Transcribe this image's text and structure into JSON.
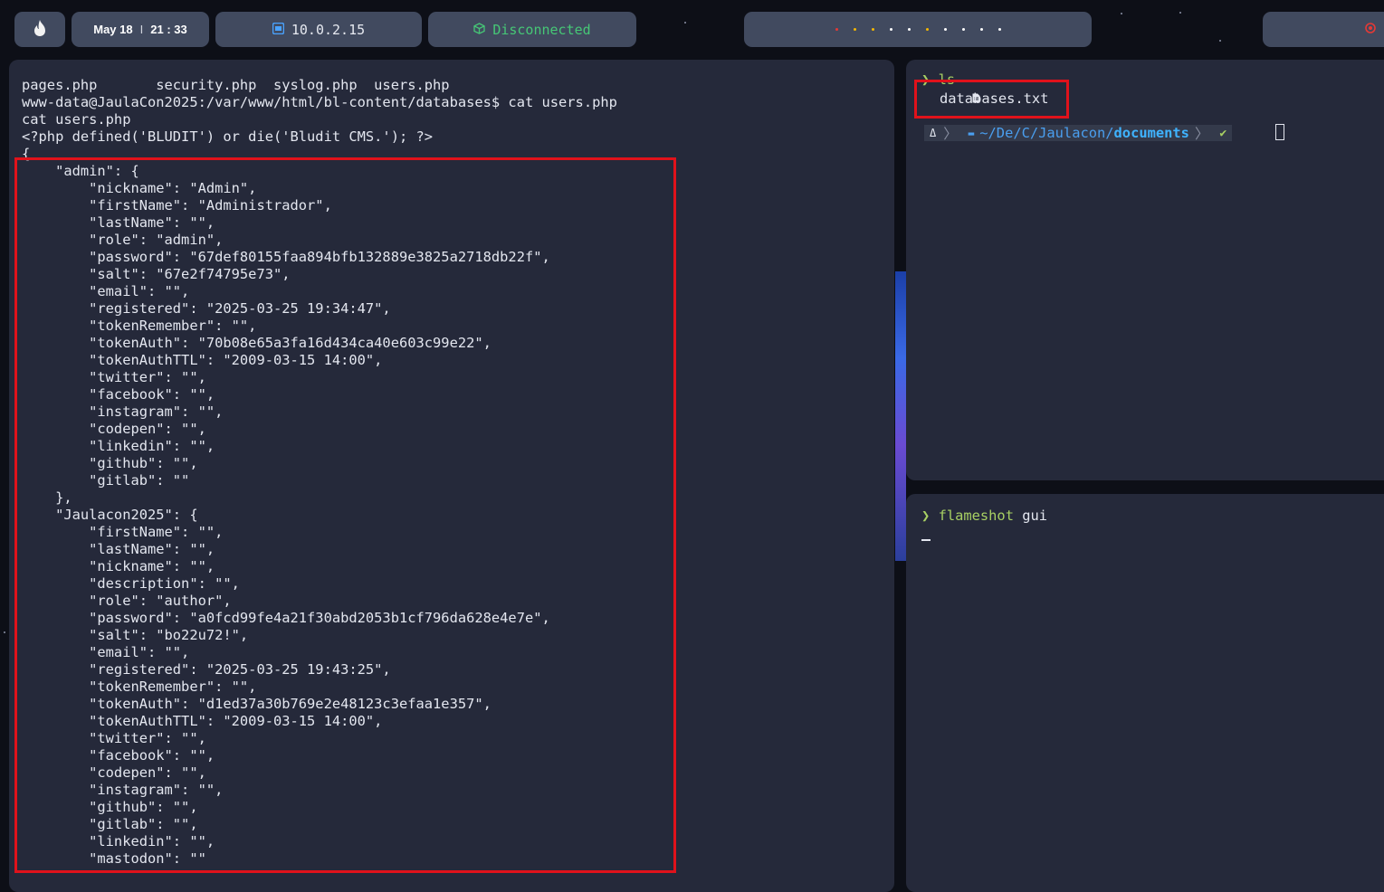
{
  "topbar": {
    "logo_icon": "flame-icon",
    "date": "May 18",
    "time": "21 : 33",
    "date_sep": "I",
    "ip": "10.0.2.15",
    "ip_icon": "network-icon",
    "vpn_status": "Disconnected",
    "vpn_icon": "cube-icon",
    "vpn_color": "#46c776",
    "workspace_dots": [
      "#e53935",
      "#f5b800",
      "#f5b800",
      "#ffffff",
      "#ffffff",
      "#f5b800",
      "#ffffff",
      "#ffffff",
      "#ffffff",
      "#ffffff"
    ],
    "power_icon": "power-icon",
    "power_color": "#e53935"
  },
  "left_terminal": {
    "lines": [
      "pages.php       security.php  syslog.php  users.php",
      "www-data@JaulaCon2025:/var/www/html/bl-content/databases$ cat users.php",
      "cat users.php",
      "<?php defined('BLUDIT') or die('Bludit CMS.'); ?>",
      "{",
      "    \"admin\": {",
      "        \"nickname\": \"Admin\",",
      "        \"firstName\": \"Administrador\",",
      "        \"lastName\": \"\",",
      "        \"role\": \"admin\",",
      "        \"password\": \"67def80155faa894bfb132889e3825a2718db22f\",",
      "        \"salt\": \"67e2f74795e73\",",
      "        \"email\": \"\",",
      "        \"registered\": \"2025-03-25 19:34:47\",",
      "        \"tokenRemember\": \"\",",
      "        \"tokenAuth\": \"70b08e65a3fa16d434ca40e603c99e22\",",
      "        \"tokenAuthTTL\": \"2009-03-15 14:00\",",
      "        \"twitter\": \"\",",
      "        \"facebook\": \"\",",
      "        \"instagram\": \"\",",
      "        \"codepen\": \"\",",
      "        \"linkedin\": \"\",",
      "        \"github\": \"\",",
      "        \"gitlab\": \"\"",
      "    },",
      "    \"Jaulacon2025\": {",
      "        \"firstName\": \"\",",
      "        \"lastName\": \"\",",
      "        \"nickname\": \"\",",
      "        \"description\": \"\",",
      "        \"role\": \"author\",",
      "        \"password\": \"a0fcd99fe4a21f30abd2053b1cf796da628e4e7e\",",
      "        \"salt\": \"bo22u72!\",",
      "        \"email\": \"\",",
      "        \"registered\": \"2025-03-25 19:43:25\",",
      "        \"tokenRemember\": \"\",",
      "        \"tokenAuth\": \"d1ed37a30b769e2e48123c3efaa1e357\",",
      "        \"tokenAuthTTL\": \"2009-03-15 14:00\",",
      "        \"twitter\": \"\",",
      "        \"facebook\": \"\",",
      "        \"codepen\": \"\",",
      "        \"instagram\": \"\",",
      "        \"github\": \"\",",
      "        \"gitlab\": \"\",",
      "        \"linkedin\": \"\",",
      "        \"mastodon\": \"\""
    ]
  },
  "right_top_terminal": {
    "prompt_symbol": "❯",
    "command": "ls",
    "file_icon": "file-icon",
    "file": "databases.txt",
    "prompt": {
      "os_icon": "linux-icon",
      "folder_icon": "folder-icon",
      "path_prefix": "~/De/C/Jaulacon/",
      "path_current": "documents",
      "status": "✔",
      "status_color": "#a8d063"
    }
  },
  "right_bottom_terminal": {
    "prompt_symbol": "❯",
    "command": "flameshot",
    "arg": "gui"
  }
}
